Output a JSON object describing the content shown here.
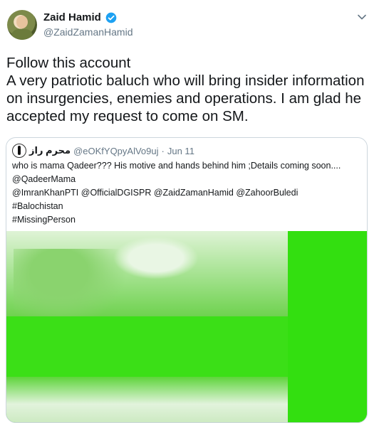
{
  "author": {
    "display_name": "Zaid Hamid",
    "handle": "@ZaidZamanHamid",
    "verified_icon": "verified-badge-icon",
    "accent_color": "#1da1f2"
  },
  "tweet": {
    "text": "Follow this account\nA very patriotic baluch who will bring insider information on insurgencies, enemies and operations. I am glad he accepted my request to come on SM."
  },
  "quoted_tweet": {
    "display_name": "محرم راز",
    "handle": "@eOKfYQpyAlVo9uj",
    "separator": "·",
    "date": "Jun 11",
    "lines": [
      "who is mama Qadeer??? His motive and hands behind him ;Details coming soon....",
      "@QadeerMama",
      "@ImranKhanPTI @OfficialDGISPR @ZaidZamanHamid @ZahoorBuledi",
      "#Balochistan",
      "#MissingPerson"
    ]
  }
}
